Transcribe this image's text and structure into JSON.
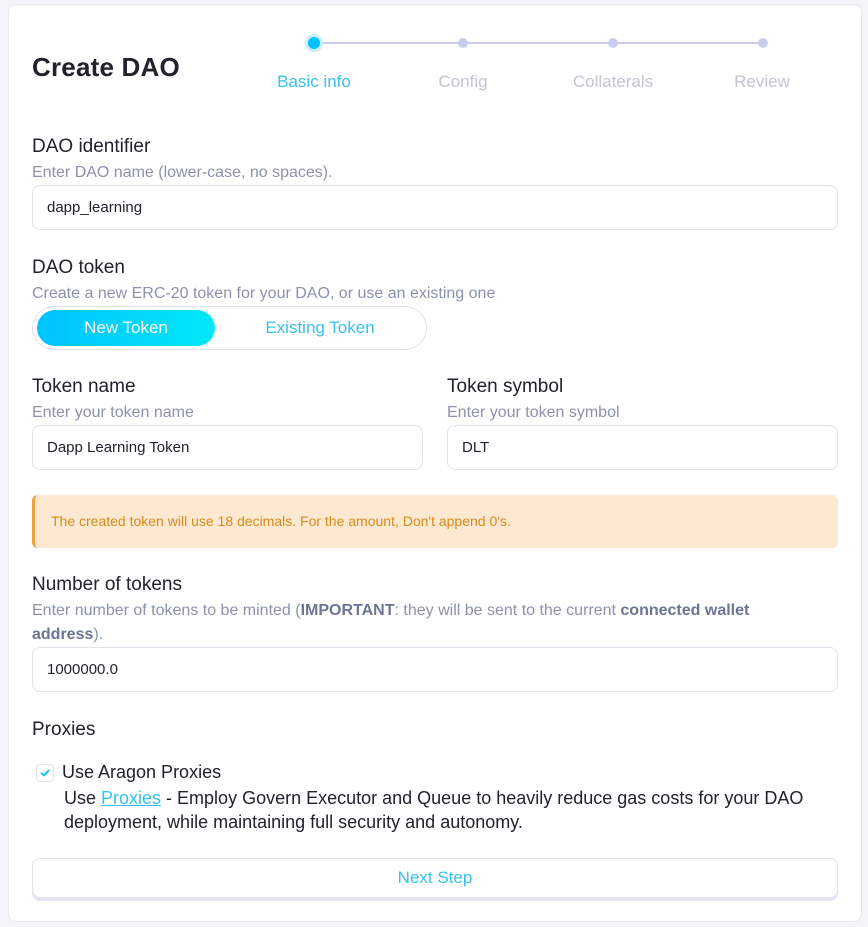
{
  "header": {
    "title": "Create DAO"
  },
  "stepper": {
    "steps": [
      "Basic info",
      "Config",
      "Collaterals",
      "Review"
    ],
    "active_step": "Basic info"
  },
  "dao_identifier": {
    "label": "DAO identifier",
    "hint": "Enter DAO name (lower-case, no spaces).",
    "value": "dapp_learning"
  },
  "dao_token": {
    "label": "DAO token",
    "hint": "Create a new ERC-20 token for your DAO, or use an existing one",
    "options": [
      "New Token",
      "Existing Token"
    ],
    "selected": "New Token"
  },
  "token_name": {
    "label": "Token name",
    "hint": "Enter your token name",
    "value": "Dapp Learning Token"
  },
  "token_symbol": {
    "label": "Token symbol",
    "hint": "Enter your token symbol",
    "value": "DLT"
  },
  "warning": {
    "text": "The created token will use 18 decimals. For the amount, Don't append 0's."
  },
  "num_tokens": {
    "label": "Number of tokens",
    "hint_prefix": "Enter number of tokens to be minted (",
    "hint_important": "IMPORTANT",
    "hint_middle": ": they will be sent to the current ",
    "hint_bold": "connected wallet address",
    "hint_suffix": ").",
    "value": "1000000.0"
  },
  "proxies": {
    "heading": "Proxies",
    "checkbox_label": "Use Aragon Proxies",
    "checked": true,
    "desc_prefix": "Use ",
    "desc_link": "Proxies",
    "desc_suffix": " - Employ Govern Executor and Queue to heavily reduce gas costs for your DAO deployment, while maintaining full security and autonomy."
  },
  "actions": {
    "next_label": "Next Step"
  },
  "colors": {
    "accent": "#00c2ff",
    "accent_text": "#35c2ef",
    "warning_bg": "#fde9d2",
    "warning_text": "#d98a1a",
    "step_inactive": "#c9ccee"
  }
}
